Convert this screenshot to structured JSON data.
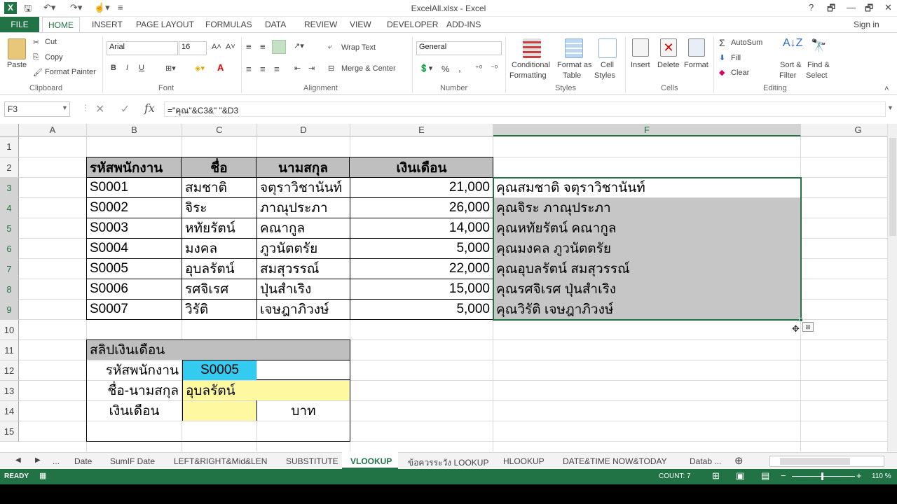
{
  "titlebar": {
    "title": "ExcelAll.xlsx - Excel",
    "help": "?",
    "restore": "🗗",
    "minimize": "—",
    "maximize": "🗗",
    "close": "✕"
  },
  "ribbon_tabs": [
    "FILE",
    "HOME",
    "INSERT",
    "PAGE LAYOUT",
    "FORMULAS",
    "DATA",
    "REVIEW",
    "VIEW",
    "DEVELOPER",
    "ADD-INS"
  ],
  "signin": "Sign in",
  "clipboard": {
    "paste": "Paste",
    "cut": "Cut",
    "copy": "Copy",
    "format_painter": "Format Painter",
    "label": "Clipboard"
  },
  "font": {
    "name": "Arial",
    "size": "16",
    "label": "Font",
    "bold": "B",
    "italic": "I",
    "underline": "U"
  },
  "alignment": {
    "wrap": "Wrap Text",
    "merge": "Merge & Center",
    "label": "Alignment"
  },
  "number": {
    "format": "General",
    "label": "Number",
    "percent": "%",
    "comma": ","
  },
  "styles": {
    "conditional": "Conditional",
    "conditional2": "Formatting",
    "format_as": "Format as",
    "format_as2": "Table",
    "cell": "Cell",
    "cell2": "Styles",
    "label": "Styles"
  },
  "cells": {
    "insert": "Insert",
    "delete": "Delete",
    "format": "Format",
    "label": "Cells"
  },
  "editing": {
    "autosum": "AutoSum",
    "fill": "Fill",
    "clear": "Clear",
    "sort": "Sort &",
    "sort2": "Filter",
    "find": "Find &",
    "find2": "Select",
    "label": "Editing"
  },
  "namebox": "F3",
  "formula": "=\"คุณ\"&C3&\" \"&D3",
  "fx": "fx",
  "columns": [
    "A",
    "B",
    "C",
    "D",
    "E",
    "F",
    "G"
  ],
  "rows": [
    "1",
    "2",
    "3",
    "4",
    "5",
    "6",
    "7",
    "8",
    "9",
    "10",
    "11",
    "12",
    "13",
    "14",
    "15"
  ],
  "table_headers": [
    "รหัสพนักงาน",
    "ชื่อ",
    "นามสกุล",
    "เงินเดือน"
  ],
  "table_rows": [
    [
      "S0001",
      "สมชาติ",
      "จตุราวิชานันท์",
      "21,000",
      "คุณสมชาติ จตุราวิชานันท์"
    ],
    [
      "S0002",
      "จิระ",
      "ภาณุประภา",
      "26,000",
      "คุณจิระ ภาณุประภา"
    ],
    [
      "S0003",
      "หทัยรัตน์",
      "คณากูล",
      "14,000",
      "คุณหทัยรัตน์ คณากูล"
    ],
    [
      "S0004",
      "มงคล",
      "ภูวนัตตรัย",
      "5,000",
      "คุณมงคล ภูวนัตตรัย"
    ],
    [
      "S0005",
      "อุบลรัตน์",
      "สมสุวรรณ์",
      "22,000",
      "คุณอุบลรัตน์ สมสุวรรณ์"
    ],
    [
      "S0006",
      "รศจิเรศ",
      "ปุ่นสำเริง",
      "15,000",
      "คุณรศจิเรศ ปุ่นสำเริง"
    ],
    [
      "S0007",
      "วิรัติ",
      "เจษฎาภิวงษ์",
      "5,000",
      "คุณวิรัติ เจษฎาภิวงษ์"
    ]
  ],
  "slip": {
    "title": "สลิปเงินเดือน",
    "id_label": "รหัสพนักงาน",
    "id_value": "S0005",
    "name_label": "ชื่อ-นามสกุล",
    "name_value": "อุบลรัตน์",
    "salary_label": "เงินเดือน",
    "unit": "บาท"
  },
  "sheet_tabs": [
    "...",
    "Date",
    "SumIF Date",
    "LEFT&RIGHT&Mid&LEN",
    "SUBSTITUTE",
    "VLOOKUP",
    "ข้อควรระวัง LOOKUP",
    "HLOOKUP",
    "DATE&TIME  NOW&TODAY",
    "Datab ..."
  ],
  "active_sheet": "VLOOKUP",
  "status": {
    "ready": "READY",
    "count": "COUNT: 7",
    "zoom": "110 %"
  },
  "colors": {
    "excel_green": "#217346",
    "header_gray": "#bfbfbf",
    "selection_gray": "#c6c6c6",
    "cyan": "#33ccf0",
    "yellow": "#fef9a0"
  }
}
